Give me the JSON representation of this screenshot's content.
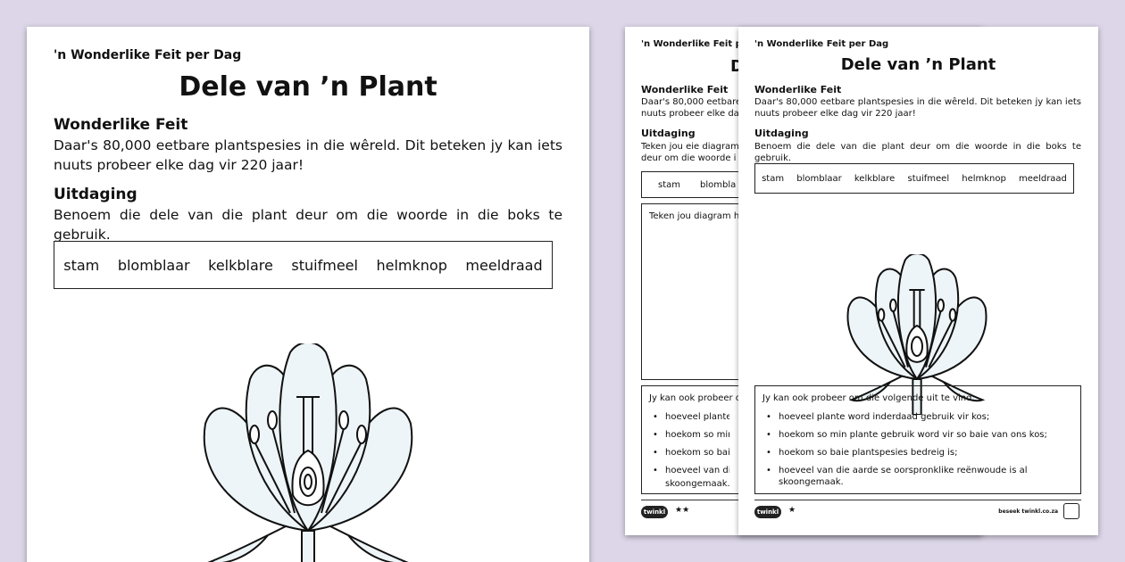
{
  "sheet_main": {
    "series": "'n Wonderlike Feit per Dag",
    "title": "Dele van ’n Plant",
    "fact_heading": "Wonderlike Feit",
    "fact_text": "Daar's 80,000 eetbare plantspesies in die wêreld. Dit beteken jy kan iets nuuts probeer elke dag vir 220 jaar!",
    "challenge_heading": "Uitdaging",
    "challenge_text": "Benoem die dele van die plant deur om die woorde in die boks te gebruik.",
    "words": [
      "stam",
      "blomblaar",
      "kelkblare",
      "stuifmeel",
      "helmknop",
      "meeldraad"
    ]
  },
  "sheet_back": {
    "series": "'n Wonderlike Feit per Dag",
    "title": "D",
    "fact_heading": "Wonderlike Feit",
    "fact_line1": "Daar's 80,000 eetbare",
    "fact_line2": "nuuts probeer elke da",
    "challenge_heading": "Uitdaging",
    "challenge_line1": "Teken jou eie diagram",
    "challenge_line2": "deur om die woorde i",
    "words": [
      "stam",
      "blombla"
    ],
    "draw_label": "Teken jou diagram h",
    "list_intro": "Jy kan ook probeer o",
    "list_items": [
      "hoeveel plante w",
      "hoekom so min",
      "hoekom so baie",
      "hoeveel van die",
      "skoongemaak."
    ],
    "stars": "★★",
    "logo": "twinkl"
  },
  "sheet_front": {
    "series": "'n Wonderlike Feit per Dag",
    "title": "Dele van ’n Plant",
    "fact_heading": "Wonderlike Feit",
    "fact_text": "Daar's 80,000 eetbare plantspesies in die wêreld. Dit beteken jy kan iets nuuts probeer elke dag vir 220 jaar!",
    "challenge_heading": "Uitdaging",
    "challenge_text": "Benoem die dele van die plant deur om die woorde in die boks te gebruik.",
    "words": [
      "stam",
      "blomblaar",
      "kelkblare",
      "stuifmeel",
      "helmknop",
      "meeldraad"
    ],
    "list_intro": "Jy kan ook probeer om die volgende uit te vind:",
    "list_items": [
      "hoeveel plante word inderdaad gebruik vir kos;",
      "hoekom so min plante gebruik word vir so baie van ons kos;",
      "hoekom so baie plantspesies bedreig is;",
      "hoeveel van die aarde se oorspronklike reënwoude is al skoongemaak."
    ],
    "stars": "★",
    "logo": "twinkl",
    "site": "beseek twinkl.co.za"
  }
}
